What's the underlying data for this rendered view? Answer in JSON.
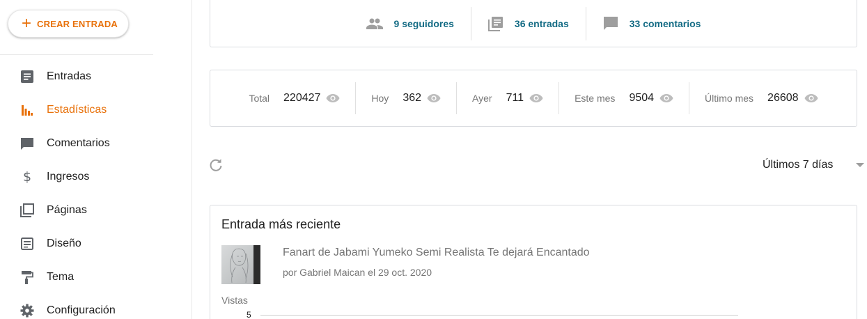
{
  "sidebar": {
    "create_label": "CREAR ENTRADA",
    "items": [
      {
        "label": "Entradas",
        "icon": "posts-icon",
        "active": false
      },
      {
        "label": "Estadísticas",
        "icon": "stats-icon",
        "active": true
      },
      {
        "label": "Comentarios",
        "icon": "comments-icon",
        "active": false
      },
      {
        "label": "Ingresos",
        "icon": "dollar-icon",
        "active": false
      },
      {
        "label": "Páginas",
        "icon": "pages-icon",
        "active": false
      },
      {
        "label": "Diseño",
        "icon": "layout-icon",
        "active": false
      },
      {
        "label": "Tema",
        "icon": "paint-roller-icon",
        "active": false
      },
      {
        "label": "Configuración",
        "icon": "gear-icon",
        "active": false
      }
    ]
  },
  "summary": {
    "followers": "9 seguidores",
    "posts": "36 entradas",
    "comments": "33 comentarios"
  },
  "stats": [
    {
      "label": "Total",
      "value": "220427"
    },
    {
      "label": "Hoy",
      "value": "362"
    },
    {
      "label": "Ayer",
      "value": "711"
    },
    {
      "label": "Este mes",
      "value": "9504"
    },
    {
      "label": "Último mes",
      "value": "26608"
    }
  ],
  "filter": {
    "period": "Últimos 7 días"
  },
  "recent": {
    "heading": "Entrada más reciente",
    "post_title": "Fanart de Jabami Yumeko Semi Realista Te dejará Encantado",
    "post_meta": "por Gabriel Maican el 29 oct. 2020",
    "chart_label": "Vistas",
    "chart_tick": "5"
  },
  "colors": {
    "accent": "#e8710a",
    "link": "#136b84",
    "icon": "#5f6368"
  }
}
